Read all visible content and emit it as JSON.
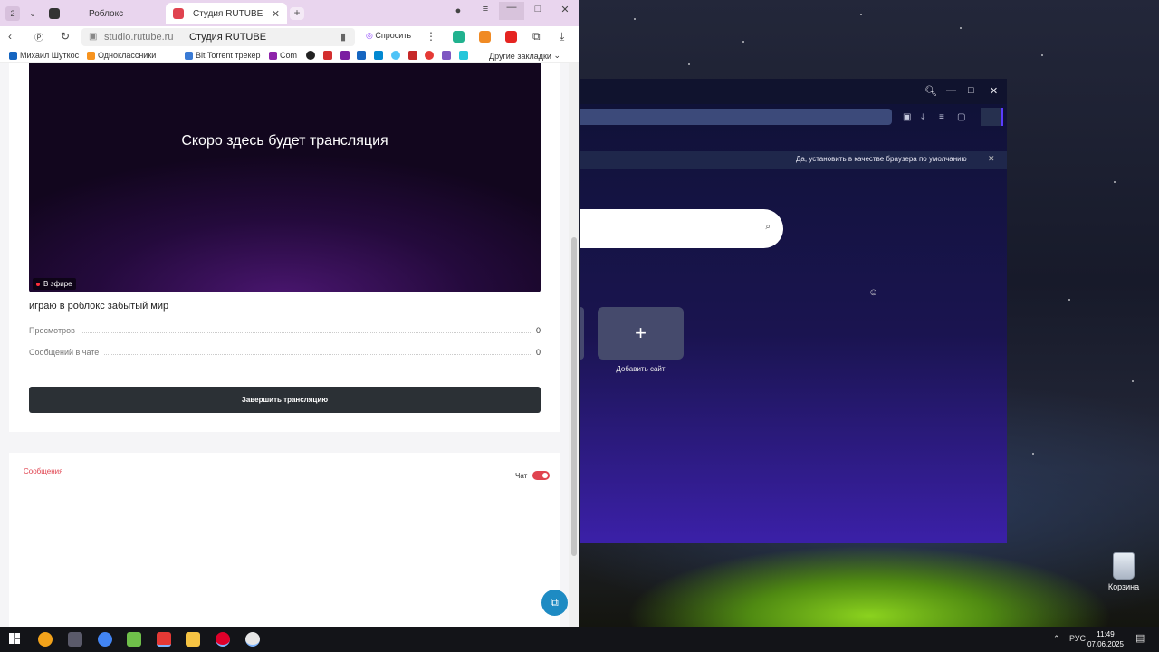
{
  "browser": {
    "tab_counter": "2",
    "tabs": [
      {
        "label": "Роблокс",
        "active": false
      },
      {
        "label": "Студия RUTUBE",
        "active": true
      }
    ],
    "address": {
      "domain": "studio.rutube.ru",
      "title": "Студия RUTUBE"
    },
    "ask_label": "Спросить",
    "bookmarks": [
      {
        "label": "Михаил Шуткос",
        "color": "#1565c0"
      },
      {
        "label": "Одноклассники",
        "color": "#f7931e"
      },
      {
        "label": "Bit Torrent трекер",
        "color": "#3a7bd5"
      },
      {
        "label": "Com",
        "color": "#8e24aa"
      }
    ],
    "other_bookmarks": "Другие закладки"
  },
  "stream": {
    "placeholder": "Скоро здесь будет трансляция",
    "live_badge": "В эфире",
    "title": "играю в роблокс забытый мир",
    "stats": [
      {
        "label": "Просмотров",
        "value": "0"
      },
      {
        "label": "Сообщений в чате",
        "value": "0"
      }
    ],
    "end_button": "Завершить трансляцию"
  },
  "chat": {
    "tab_label": "Сообщения",
    "toggle_label": "Чат",
    "toggle_on": true
  },
  "second_window": {
    "notice": "Да, установить в качестве браузера по умолчанию",
    "add_site": "Добавить сайт"
  },
  "desktop": {
    "recycle_bin": "Корзина"
  },
  "taskbar": {
    "lang": "РУС",
    "time": "11:49",
    "date": "07.06.2025"
  },
  "colors": {
    "accent": "#e0434f",
    "dark_button": "#2b3035",
    "tabbar": "#e9d5ee"
  }
}
